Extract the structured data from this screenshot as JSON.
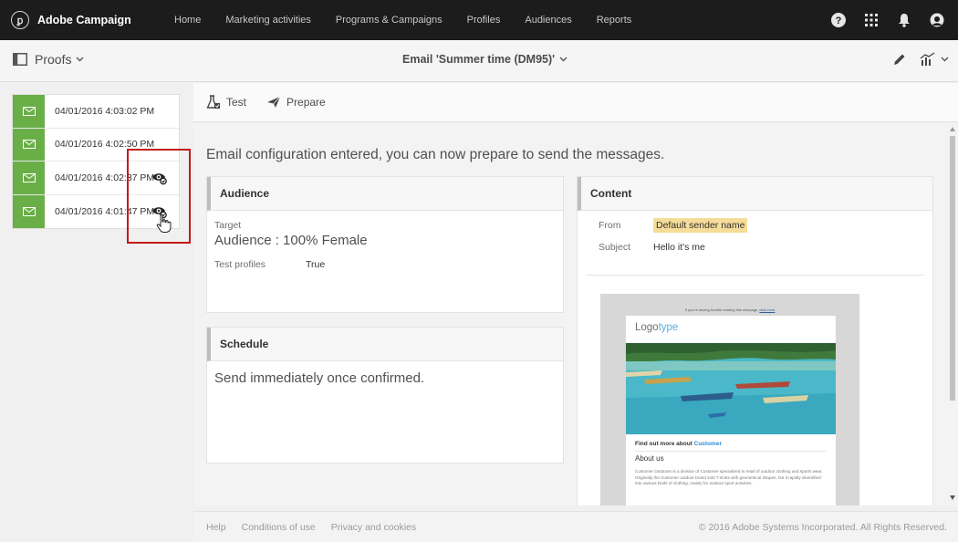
{
  "app": {
    "name": "Adobe Campaign",
    "logo_glyph": "ꝑ"
  },
  "nav": {
    "items": [
      "Home",
      "Marketing activities",
      "Programs & Campaigns",
      "Profiles",
      "Audiences",
      "Reports"
    ]
  },
  "topbar_icons": [
    "help-icon",
    "apps-grid-icon",
    "notifications-bell-icon",
    "user-avatar-icon"
  ],
  "subbar": {
    "panel_label": "Proofs",
    "title": "Email 'Summer time (DM95)'",
    "icons": [
      "edit-pencil-icon",
      "report-chart-icon"
    ]
  },
  "proofs": [
    {
      "date": "04/01/2016 4:03:02 PM",
      "has_eye": false
    },
    {
      "date": "04/01/2016 4:02:50 PM",
      "has_eye": false
    },
    {
      "date": "04/01/2016 4:02:37 PM",
      "has_eye": true
    },
    {
      "date": "04/01/2016 4:01:47 PM",
      "has_eye": true
    }
  ],
  "toolbar": {
    "test_label": "Test",
    "prepare_label": "Prepare"
  },
  "main": {
    "headline": "Email configuration entered, you can now prepare to send the messages.",
    "audience": {
      "title": "Audience",
      "target_label": "Target",
      "target_value": "Audience : 100% Female",
      "test_profiles_label": "Test profiles",
      "test_profiles_value": "True"
    },
    "schedule": {
      "title": "Schedule",
      "value": "Send immediately once confirmed."
    },
    "content": {
      "title": "Content",
      "from_label": "From",
      "from_value": "Default sender name",
      "subject_label": "Subject",
      "subject_value": "Hello it's me"
    }
  },
  "email_preview": {
    "top_line": "If you're having trouble reading this message,",
    "top_link": "click here",
    "logo_main": "Logo",
    "logo_accent": "type",
    "find_text": "Find out more about",
    "find_brand": "Customer",
    "about_title": "About us",
    "about_text": "Customer Outdoors is a division of Customer specialized in retail of outdoor clothing and sports wear. Originally the Customer outdoor brand sold T-shirts with geometrical shapes, but it rapidly diversified into various kinds of clothing, mainly for outdoor sport activities."
  },
  "footer": {
    "links": [
      "Help",
      "Conditions of use",
      "Privacy and cookies"
    ],
    "copyright": "© 2016 Adobe Systems Incorporated. All Rights Reserved."
  },
  "colors": {
    "topbar": "#1c1c1c",
    "proof_badge": "#6aae48",
    "highlight_frame": "#c41a1a",
    "from_highlight": "#f5dc98",
    "link_blue": "#2a8bd5"
  }
}
